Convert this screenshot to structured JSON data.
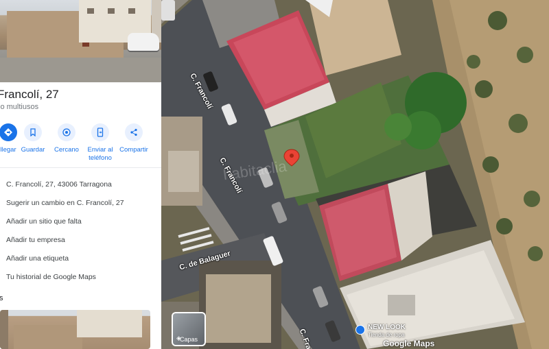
{
  "place": {
    "title": "Francolí, 27",
    "subtitle": "io multiusos"
  },
  "actions": [
    {
      "label": "llegar",
      "icon": "directions-icon"
    },
    {
      "label": "Guardar",
      "icon": "bookmark-icon"
    },
    {
      "label": "Cercano",
      "icon": "nearby-icon"
    },
    {
      "label": "Enviar al teléfono",
      "icon": "send-to-phone-icon"
    },
    {
      "label": "Compartir",
      "icon": "share-icon"
    }
  ],
  "info": [
    {
      "text": "C. Francolí, 27, 43006 Tarragona",
      "icon": "location-icon"
    },
    {
      "text": "Sugerir un cambio en C. Francolí, 27",
      "icon": "edit-icon"
    },
    {
      "text": "Añadir un sitio que falta",
      "icon": "add-place-icon"
    },
    {
      "text": "Añadir tu empresa",
      "icon": "business-icon"
    },
    {
      "text": "Añadir una etiqueta",
      "icon": "label-icon"
    },
    {
      "text": "Tu historial de Google Maps",
      "icon": "history-icon"
    }
  ],
  "section_label": "s",
  "map": {
    "roads": [
      "C. Francolí",
      "C. Francolí",
      "C. de Balaguer",
      "C. Fra"
    ],
    "watermark": "habitaclia",
    "layers_label": "Capas",
    "poi": {
      "name": "NEW LOOK",
      "category": "Tienda de ropa"
    },
    "logo": "Google Maps"
  },
  "colors": {
    "accent": "#1a73e8",
    "pin": "#ea4335"
  }
}
